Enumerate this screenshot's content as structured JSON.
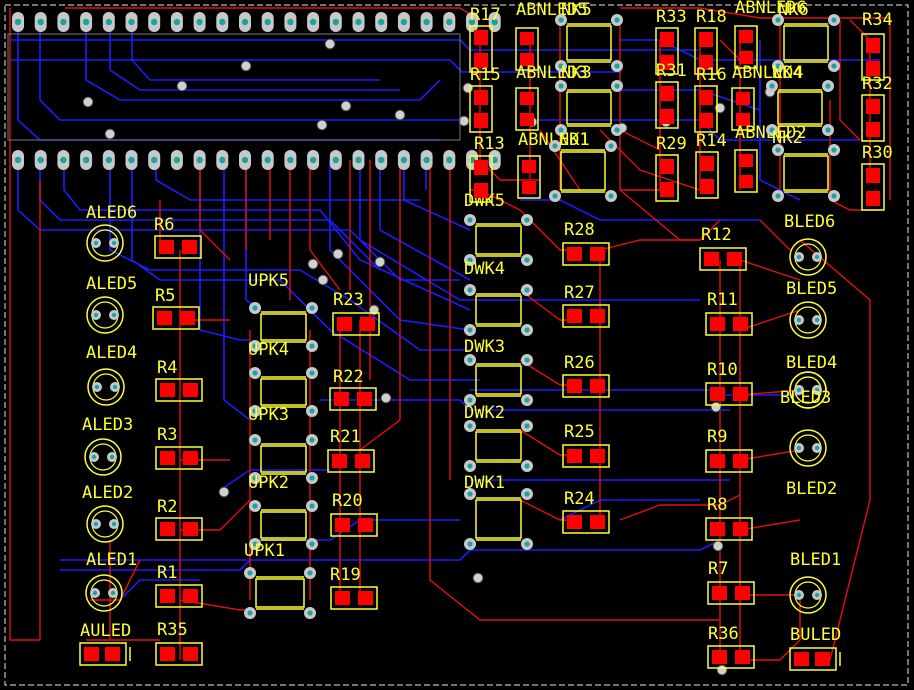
{
  "colors": {
    "background": "#000000",
    "outline": "#9a9a9a",
    "silkscreen": "#ffff33",
    "top_trace": "#e01010",
    "bottom_trace": "#1c1cff",
    "smd_pad": "#ff0000",
    "th_pad": "#c8c8c8",
    "drill": "#1aa3a3",
    "via": "#d0d0d0"
  },
  "chip_pins": 22,
  "labels": {
    "AULED": "AULED",
    "R35": "R35",
    "ALED1": "ALED1",
    "R1": "R1",
    "ALED2": "ALED2",
    "R2": "R2",
    "ALED3": "ALED3",
    "R3": "R3",
    "ALED4": "ALED4",
    "R4": "R4",
    "ALED5": "ALED5",
    "R5": "R5",
    "ALED6": "ALED6",
    "R6": "R6",
    "UPK1": "UPK1",
    "UPK2": "UPK2",
    "UPK3": "UPK3",
    "UPK4": "UPK4",
    "UPK5": "UPK5",
    "R19": "R19",
    "R20": "R20",
    "R21": "R21",
    "R22": "R22",
    "R23": "R23",
    "DWK1": "DWK1",
    "DWK2": "DWK2",
    "DWK3": "DWK3",
    "DWK4": "DWK4",
    "DWK5": "DWK5",
    "R24": "R24",
    "R25": "R25",
    "R26": "R26",
    "R27": "R27",
    "R28": "R28",
    "R7": "R7",
    "R8": "R8",
    "R9": "R9",
    "R10": "R10",
    "R11": "R11",
    "R12": "R12",
    "R36": "R36",
    "BLED1": "BLED1",
    "BLED2": "BLED2",
    "BLED3": "BLED3",
    "BLED4": "BLED4",
    "BLED5": "BLED5",
    "BLED6": "BLED6",
    "BULED": "BULED",
    "R13": "R13",
    "R14": "R14",
    "R15": "R15",
    "R16": "R16",
    "R17": "R17",
    "R18": "R18",
    "R29": "R29",
    "R30": "R30",
    "R31": "R31",
    "R32": "R32",
    "R33": "R33",
    "R34": "R34",
    "ABNLED1": "ABNLED1",
    "ABNLED2": "ABNLED2",
    "ABNLED3": "ABNLED3",
    "ABNLED4": "ABNLED4",
    "ABNLED5": "ABNLED5",
    "ABNLED6": "ABNLED6",
    "NK1": "NK1",
    "NK2": "NK2",
    "NK3": "NK3",
    "NK4": "NK4",
    "NK5": "NK5",
    "NK6": "NK6"
  }
}
